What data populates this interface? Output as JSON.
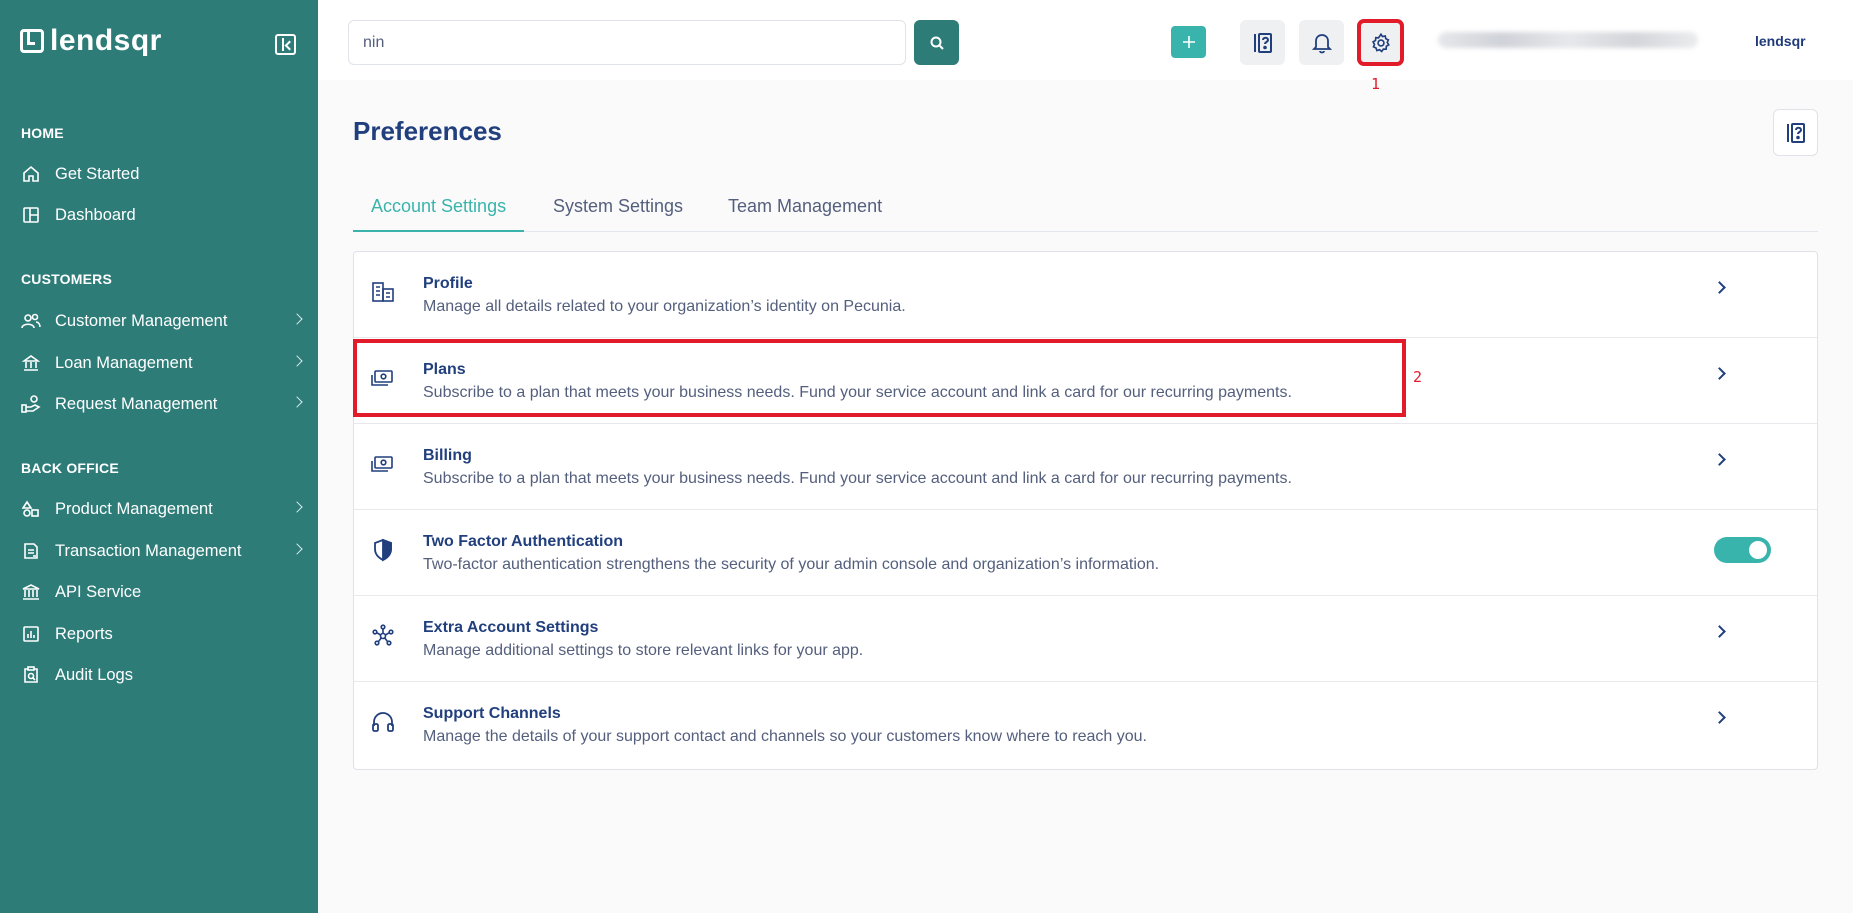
{
  "brand": {
    "name": "lendsqr",
    "small_name": "lendsqr"
  },
  "sidebar": {
    "sections": [
      {
        "title": "HOME",
        "items": [
          {
            "label": "Get Started",
            "icon": "home-icon"
          },
          {
            "label": "Dashboard",
            "icon": "dashboard-icon"
          }
        ]
      },
      {
        "title": "CUSTOMERS",
        "items": [
          {
            "label": "Customer Management",
            "icon": "users-icon",
            "expandable": true
          },
          {
            "label": "Loan Management",
            "icon": "loan-icon",
            "expandable": true
          },
          {
            "label": "Request Management",
            "icon": "request-icon",
            "expandable": true
          }
        ]
      },
      {
        "title": "BACK OFFICE",
        "items": [
          {
            "label": "Product Management",
            "icon": "product-icon",
            "expandable": true
          },
          {
            "label": "Transaction Management",
            "icon": "transaction-icon",
            "expandable": true
          },
          {
            "label": "API Service",
            "icon": "bank-icon"
          },
          {
            "label": "Reports",
            "icon": "reports-icon"
          },
          {
            "label": "Audit Logs",
            "icon": "audit-icon"
          }
        ]
      }
    ]
  },
  "topbar": {
    "search_value": "nin",
    "markers": {
      "settings": "1",
      "plans": "2"
    }
  },
  "page": {
    "title": "Preferences",
    "tabs": [
      {
        "label": "Account Settings",
        "active": true
      },
      {
        "label": "System Settings",
        "active": false
      },
      {
        "label": "Team Management",
        "active": false
      }
    ],
    "rows": [
      {
        "title": "Profile",
        "desc": "Manage all details related to your organization’s identity on Pecunia.",
        "icon": "building-icon",
        "control": "chevron"
      },
      {
        "title": "Plans",
        "desc": "Subscribe to a plan that meets your business needs. Fund your service account and link a card for our recurring payments.",
        "icon": "money-icon",
        "control": "chevron"
      },
      {
        "title": "Billing",
        "desc": "Subscribe to a plan that meets your business needs. Fund your service account and link a card for our recurring payments.",
        "icon": "money-icon",
        "control": "chevron"
      },
      {
        "title": "Two Factor Authentication",
        "desc": "Two-factor authentication strengthens the security of your admin console and organization’s information.",
        "icon": "shield-icon",
        "control": "toggle",
        "toggle_on": true
      },
      {
        "title": "Extra Account Settings",
        "desc": "Manage additional settings to store relevant links for your app.",
        "icon": "network-icon",
        "control": "chevron"
      },
      {
        "title": "Support Channels",
        "desc": "Manage the details of your support contact and channels so your customers know where to reach you.",
        "icon": "headphones-icon",
        "control": "chevron"
      }
    ]
  },
  "colors": {
    "sidebar": "#2d7c78",
    "accent": "#39b4ac",
    "title": "#213f7d",
    "annotation": "#e21b2a"
  }
}
